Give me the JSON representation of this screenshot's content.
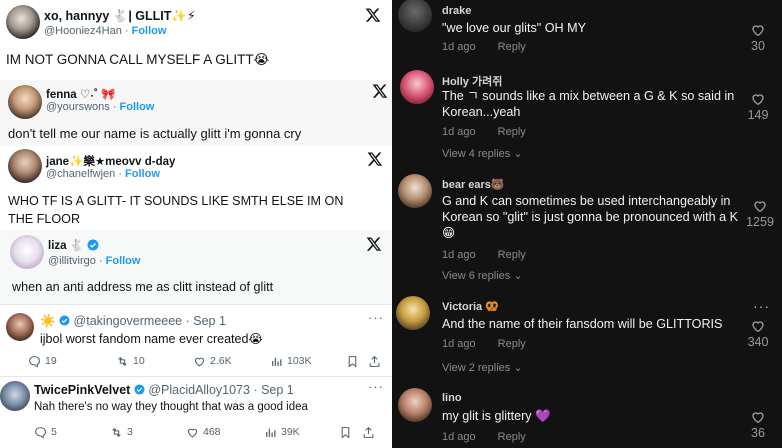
{
  "x_cards": [
    {
      "name": "xo, hannyy 🐇| GLLIT✨⚡",
      "handle": "@Hooniez4Han",
      "follow": "Follow",
      "body": "IM NOT GONNA CALL MYSELF A GLITT😭"
    },
    {
      "name": "fenna ♡˖˚ 🎀",
      "handle": "@yourswons",
      "follow": "Follow",
      "body": "don't tell me our name is actually glitt i'm gonna cry"
    },
    {
      "name": "jane✨樂★meovv d-day",
      "handle": "@chanelfwjen",
      "follow": "Follow",
      "body": "WHO TF IS A GLITT- IT SOUNDS LIKE SMTH ELSE IM ON",
      "body2": "THE FLOOR"
    },
    {
      "name": "liza 🐇",
      "handle": "@illitvirgo",
      "follow": "Follow",
      "body": "when an anti address me as clitt instead of glitt"
    }
  ],
  "tweets": [
    {
      "name": "☀️",
      "handle": "@takingovermeeee",
      "time": "· Sep 1",
      "text": "ijbol worst fandom name ever created😭",
      "replies": "19",
      "retweets": "10",
      "likes": "2.6K",
      "views": "103K"
    },
    {
      "name": "TwicePinkVelvet",
      "handle": "@PlacidAlloy1073",
      "time": "· Sep 1",
      "text": "Nah there's no way they thought that was a good idea",
      "replies": "5",
      "retweets": "3",
      "likes": "468",
      "views": "39K"
    }
  ],
  "comments": [
    {
      "user": "drake",
      "text": "\"we love our glits\" OH MY",
      "age": "1d ago",
      "reply": "Reply",
      "likes": "30"
    },
    {
      "user": "Holly 가려쥐",
      "text": "The ㄱ sounds like a mix between a G & K so said in Korean...yeah",
      "age": "1d ago",
      "reply": "Reply",
      "likes": "149",
      "view_replies": "View 4 replies ⌄"
    },
    {
      "user": "bear ears🐻",
      "text": "G and K can sometimes be used interchangeably in Korean so \"glit\" is just gonna be pronounced with a K😁",
      "age": "1d ago",
      "reply": "Reply",
      "likes": "1259",
      "view_replies": "View 6 replies ⌄"
    },
    {
      "user": "Victoria 🥨",
      "text": "And the name of their fansdom will be GLITTORIS",
      "age": "1d ago",
      "reply": "Reply",
      "likes": "340",
      "view_replies": "View 2 replies ⌄"
    },
    {
      "user": "lino",
      "text": "my glit is glittery 💜",
      "age": "1d ago",
      "reply": "Reply",
      "likes": "36"
    }
  ],
  "colors": {
    "twitter_blue": "#1d9bf0",
    "verified": "#1d9bf0",
    "tiktok_bg": "#121212"
  }
}
